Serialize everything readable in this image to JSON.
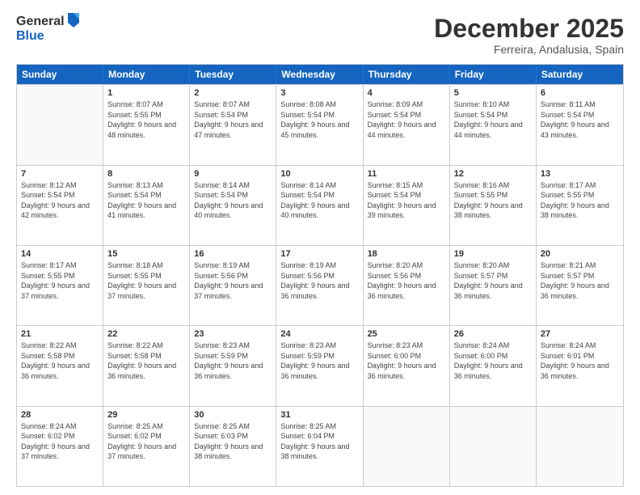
{
  "logo": {
    "general": "General",
    "blue": "Blue"
  },
  "title": "December 2025",
  "location": "Ferreira, Andalusia, Spain",
  "headers": [
    "Sunday",
    "Monday",
    "Tuesday",
    "Wednesday",
    "Thursday",
    "Friday",
    "Saturday"
  ],
  "weeks": [
    [
      {
        "day": "",
        "sunrise": "",
        "sunset": "",
        "daylight": ""
      },
      {
        "day": "1",
        "sunrise": "Sunrise: 8:07 AM",
        "sunset": "Sunset: 5:55 PM",
        "daylight": "Daylight: 9 hours and 48 minutes."
      },
      {
        "day": "2",
        "sunrise": "Sunrise: 8:07 AM",
        "sunset": "Sunset: 5:54 PM",
        "daylight": "Daylight: 9 hours and 47 minutes."
      },
      {
        "day": "3",
        "sunrise": "Sunrise: 8:08 AM",
        "sunset": "Sunset: 5:54 PM",
        "daylight": "Daylight: 9 hours and 45 minutes."
      },
      {
        "day": "4",
        "sunrise": "Sunrise: 8:09 AM",
        "sunset": "Sunset: 5:54 PM",
        "daylight": "Daylight: 9 hours and 44 minutes."
      },
      {
        "day": "5",
        "sunrise": "Sunrise: 8:10 AM",
        "sunset": "Sunset: 5:54 PM",
        "daylight": "Daylight: 9 hours and 44 minutes."
      },
      {
        "day": "6",
        "sunrise": "Sunrise: 8:11 AM",
        "sunset": "Sunset: 5:54 PM",
        "daylight": "Daylight: 9 hours and 43 minutes."
      }
    ],
    [
      {
        "day": "7",
        "sunrise": "Sunrise: 8:12 AM",
        "sunset": "Sunset: 5:54 PM",
        "daylight": "Daylight: 9 hours and 42 minutes."
      },
      {
        "day": "8",
        "sunrise": "Sunrise: 8:13 AM",
        "sunset": "Sunset: 5:54 PM",
        "daylight": "Daylight: 9 hours and 41 minutes."
      },
      {
        "day": "9",
        "sunrise": "Sunrise: 8:14 AM",
        "sunset": "Sunset: 5:54 PM",
        "daylight": "Daylight: 9 hours and 40 minutes."
      },
      {
        "day": "10",
        "sunrise": "Sunrise: 8:14 AM",
        "sunset": "Sunset: 5:54 PM",
        "daylight": "Daylight: 9 hours and 40 minutes."
      },
      {
        "day": "11",
        "sunrise": "Sunrise: 8:15 AM",
        "sunset": "Sunset: 5:54 PM",
        "daylight": "Daylight: 9 hours and 39 minutes."
      },
      {
        "day": "12",
        "sunrise": "Sunrise: 8:16 AM",
        "sunset": "Sunset: 5:55 PM",
        "daylight": "Daylight: 9 hours and 38 minutes."
      },
      {
        "day": "13",
        "sunrise": "Sunrise: 8:17 AM",
        "sunset": "Sunset: 5:55 PM",
        "daylight": "Daylight: 9 hours and 38 minutes."
      }
    ],
    [
      {
        "day": "14",
        "sunrise": "Sunrise: 8:17 AM",
        "sunset": "Sunset: 5:55 PM",
        "daylight": "Daylight: 9 hours and 37 minutes."
      },
      {
        "day": "15",
        "sunrise": "Sunrise: 8:18 AM",
        "sunset": "Sunset: 5:55 PM",
        "daylight": "Daylight: 9 hours and 37 minutes."
      },
      {
        "day": "16",
        "sunrise": "Sunrise: 8:19 AM",
        "sunset": "Sunset: 5:56 PM",
        "daylight": "Daylight: 9 hours and 37 minutes."
      },
      {
        "day": "17",
        "sunrise": "Sunrise: 8:19 AM",
        "sunset": "Sunset: 5:56 PM",
        "daylight": "Daylight: 9 hours and 36 minutes."
      },
      {
        "day": "18",
        "sunrise": "Sunrise: 8:20 AM",
        "sunset": "Sunset: 5:56 PM",
        "daylight": "Daylight: 9 hours and 36 minutes."
      },
      {
        "day": "19",
        "sunrise": "Sunrise: 8:20 AM",
        "sunset": "Sunset: 5:57 PM",
        "daylight": "Daylight: 9 hours and 36 minutes."
      },
      {
        "day": "20",
        "sunrise": "Sunrise: 8:21 AM",
        "sunset": "Sunset: 5:57 PM",
        "daylight": "Daylight: 9 hours and 36 minutes."
      }
    ],
    [
      {
        "day": "21",
        "sunrise": "Sunrise: 8:22 AM",
        "sunset": "Sunset: 5:58 PM",
        "daylight": "Daylight: 9 hours and 36 minutes."
      },
      {
        "day": "22",
        "sunrise": "Sunrise: 8:22 AM",
        "sunset": "Sunset: 5:58 PM",
        "daylight": "Daylight: 9 hours and 36 minutes."
      },
      {
        "day": "23",
        "sunrise": "Sunrise: 8:23 AM",
        "sunset": "Sunset: 5:59 PM",
        "daylight": "Daylight: 9 hours and 36 minutes."
      },
      {
        "day": "24",
        "sunrise": "Sunrise: 8:23 AM",
        "sunset": "Sunset: 5:59 PM",
        "daylight": "Daylight: 9 hours and 36 minutes."
      },
      {
        "day": "25",
        "sunrise": "Sunrise: 8:23 AM",
        "sunset": "Sunset: 6:00 PM",
        "daylight": "Daylight: 9 hours and 36 minutes."
      },
      {
        "day": "26",
        "sunrise": "Sunrise: 8:24 AM",
        "sunset": "Sunset: 6:00 PM",
        "daylight": "Daylight: 9 hours and 36 minutes."
      },
      {
        "day": "27",
        "sunrise": "Sunrise: 8:24 AM",
        "sunset": "Sunset: 6:01 PM",
        "daylight": "Daylight: 9 hours and 36 minutes."
      }
    ],
    [
      {
        "day": "28",
        "sunrise": "Sunrise: 8:24 AM",
        "sunset": "Sunset: 6:02 PM",
        "daylight": "Daylight: 9 hours and 37 minutes."
      },
      {
        "day": "29",
        "sunrise": "Sunrise: 8:25 AM",
        "sunset": "Sunset: 6:02 PM",
        "daylight": "Daylight: 9 hours and 37 minutes."
      },
      {
        "day": "30",
        "sunrise": "Sunrise: 8:25 AM",
        "sunset": "Sunset: 6:03 PM",
        "daylight": "Daylight: 9 hours and 38 minutes."
      },
      {
        "day": "31",
        "sunrise": "Sunrise: 8:25 AM",
        "sunset": "Sunset: 6:04 PM",
        "daylight": "Daylight: 9 hours and 38 minutes."
      },
      {
        "day": "",
        "sunrise": "",
        "sunset": "",
        "daylight": ""
      },
      {
        "day": "",
        "sunrise": "",
        "sunset": "",
        "daylight": ""
      },
      {
        "day": "",
        "sunrise": "",
        "sunset": "",
        "daylight": ""
      }
    ]
  ]
}
